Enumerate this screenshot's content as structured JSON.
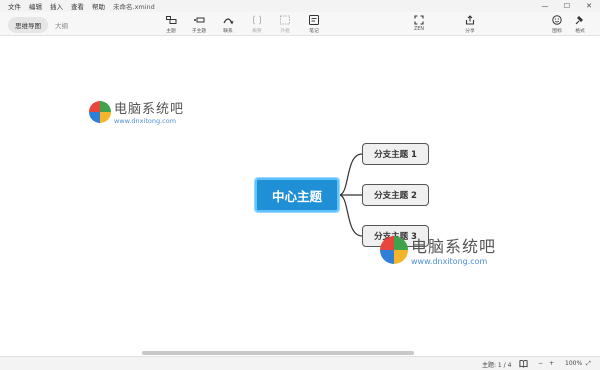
{
  "menu": [
    "文件",
    "编辑",
    "插入",
    "查看",
    "帮助"
  ],
  "window_title": "未命名.xmind",
  "window_controls": [
    "—",
    "☐",
    "✕"
  ],
  "view_tabs": [
    {
      "label": "思维导图",
      "active": true
    },
    {
      "label": "大纲",
      "active": false
    }
  ],
  "tools": [
    {
      "label": "主题",
      "icon": "topic-icon",
      "enabled": true
    },
    {
      "label": "子主题",
      "icon": "subtopic-icon",
      "enabled": true
    },
    {
      "label": "联系",
      "icon": "relationship-icon",
      "enabled": true
    },
    {
      "label": "概要",
      "icon": "summary-icon",
      "enabled": false
    },
    {
      "label": "外框",
      "icon": "boundary-icon",
      "enabled": false
    },
    {
      "label": "笔记",
      "icon": "note-icon",
      "enabled": true
    },
    {
      "label": "ZEN",
      "icon": "zen-icon",
      "enabled": true
    },
    {
      "label": "分享",
      "icon": "share-icon",
      "enabled": true
    },
    {
      "label": "图标",
      "icon": "marker-icon",
      "enabled": true
    },
    {
      "label": "格式",
      "icon": "format-icon",
      "enabled": true
    }
  ],
  "watermark": {
    "cn": "电脑系统吧",
    "en": "www.dnxitong.com"
  },
  "central_topic": "中心主题",
  "branches": [
    "分支主题 1",
    "分支主题 2",
    "分支主题 3"
  ],
  "status": {
    "topic_count": "主题: 1 / 4",
    "zoom_minus": "−",
    "zoom_plus": "+",
    "zoom": "100%",
    "expand": "⤢"
  },
  "colors": {
    "central_fill": "#1f8fd6",
    "central_border": "#5fc3ff",
    "branch_border": "#555555"
  }
}
